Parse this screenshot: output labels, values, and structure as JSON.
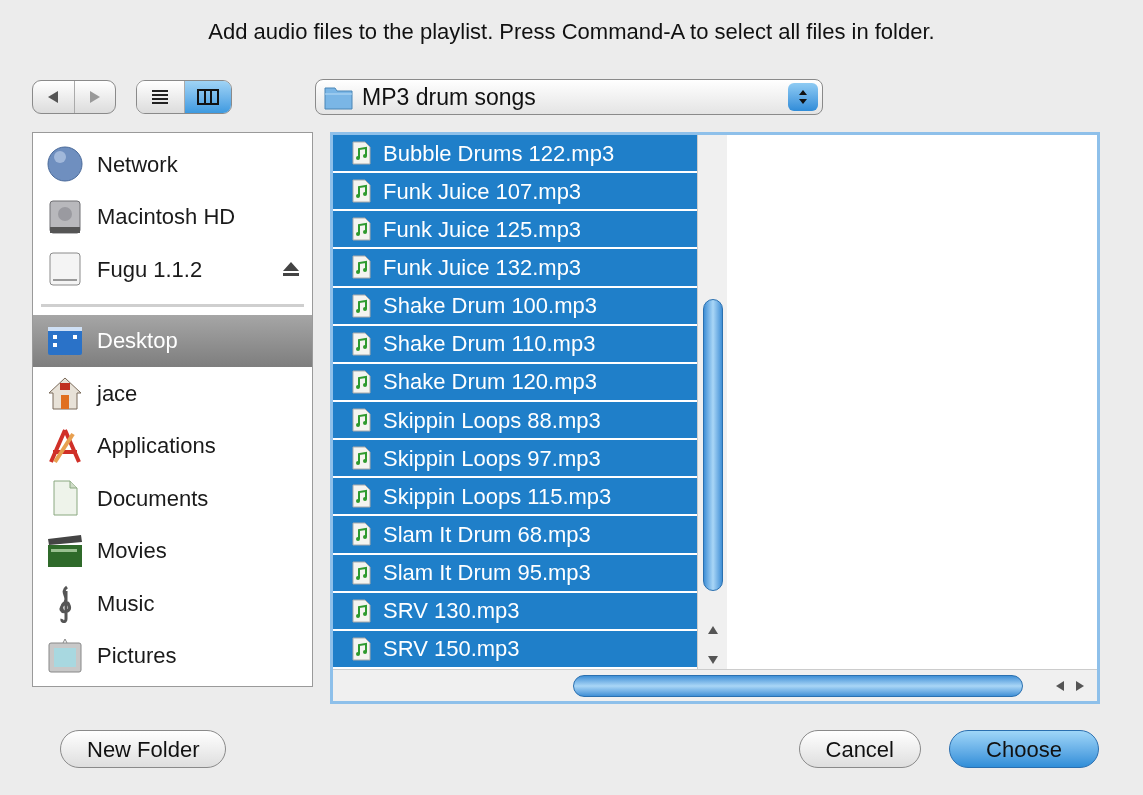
{
  "dialog": {
    "message": "Add audio files to the playlist. Press Command-A to select all files in folder."
  },
  "view_modes": [
    {
      "kind": "list",
      "selected": false
    },
    {
      "kind": "columns",
      "selected": true
    }
  ],
  "location": {
    "folder": "MP3 drum songs"
  },
  "sidebar": {
    "devices": [
      {
        "label": "Network",
        "selected": false,
        "ejectable": false
      },
      {
        "label": "Macintosh HD",
        "selected": false,
        "ejectable": false
      },
      {
        "label": "Fugu 1.1.2",
        "selected": false,
        "ejectable": true
      }
    ],
    "places": [
      {
        "label": "Desktop",
        "selected": true
      },
      {
        "label": "jace",
        "selected": false
      },
      {
        "label": "Applications",
        "selected": false
      },
      {
        "label": "Documents",
        "selected": false
      },
      {
        "label": "Movies",
        "selected": false
      },
      {
        "label": "Music",
        "selected": false
      },
      {
        "label": "Pictures",
        "selected": false
      }
    ]
  },
  "files": [
    {
      "name": "Bubble Drums 122.mp3",
      "selected": true
    },
    {
      "name": "Funk Juice 107.mp3",
      "selected": true
    },
    {
      "name": "Funk Juice 125.mp3",
      "selected": true
    },
    {
      "name": "Funk Juice 132.mp3",
      "selected": true
    },
    {
      "name": "Shake Drum 100.mp3",
      "selected": true
    },
    {
      "name": "Shake Drum 110.mp3",
      "selected": true
    },
    {
      "name": "Shake Drum 120.mp3",
      "selected": true
    },
    {
      "name": "Skippin Loops 88.mp3",
      "selected": true
    },
    {
      "name": "Skippin Loops 97.mp3",
      "selected": true
    },
    {
      "name": "Skippin Loops 115.mp3",
      "selected": true
    },
    {
      "name": "Slam It Drum 68.mp3",
      "selected": true
    },
    {
      "name": "Slam It Drum 95.mp3",
      "selected": true
    },
    {
      "name": "SRV 130.mp3",
      "selected": true
    },
    {
      "name": "SRV 150.mp3",
      "selected": true
    }
  ],
  "footer": {
    "left_buttons": [
      {
        "label": "New Folder",
        "default": false
      }
    ],
    "right_buttons": [
      {
        "label": "Cancel",
        "default": false
      },
      {
        "label": "Choose",
        "default": true
      }
    ]
  }
}
